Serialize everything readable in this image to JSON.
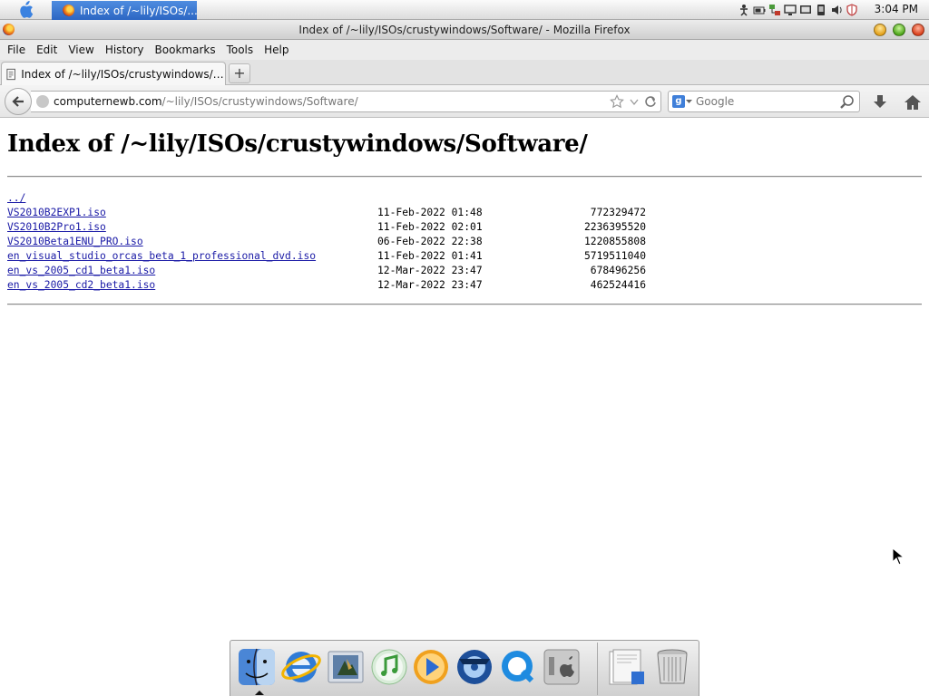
{
  "system_bar": {
    "task_label": "Index of /~lily/ISOs/...",
    "clock": "3:04 PM"
  },
  "window": {
    "title": "Index of /~lily/ISOs/crustywindows/Software/ - Mozilla Firefox"
  },
  "menu": {
    "items": [
      "File",
      "Edit",
      "View",
      "History",
      "Bookmarks",
      "Tools",
      "Help"
    ]
  },
  "tabs": {
    "active_label": "Index of /~lily/ISOs/crustywindows/So...",
    "new_tab_label": "+"
  },
  "navigation": {
    "url_domain": "computernewb.com",
    "url_path": "/~lily/ISOs/crustywindows/Software/",
    "search_engine": "Google",
    "search_placeholder": "Google"
  },
  "page": {
    "title": "Index of /~lily/ISOs/crustywindows/Software/",
    "parent_link": "../",
    "files": [
      {
        "name": "VS2010B2EXP1.iso",
        "date": "11-Feb-2022 01:48",
        "size": "772329472"
      },
      {
        "name": "VS2010B2Pro1.iso",
        "date": "11-Feb-2022 02:01",
        "size": "2236395520"
      },
      {
        "name": "VS2010Beta1ENU_PRO.iso",
        "date": "06-Feb-2022 22:38",
        "size": "1220855808"
      },
      {
        "name": "en_visual_studio_orcas_beta_1_professional_dvd.iso",
        "date": "11-Feb-2022 01:41",
        "size": "5719511040"
      },
      {
        "name": "en_vs_2005_cd1_beta1.iso",
        "date": "12-Mar-2022 23:47",
        "size": "678496256"
      },
      {
        "name": "en_vs_2005_cd2_beta1.iso",
        "date": "12-Mar-2022 23:47",
        "size": "462524416"
      }
    ]
  },
  "dock": {
    "icons": [
      "finder-icon",
      "internet-explorer-icon",
      "mail-icon",
      "itunes-icon",
      "media-player-icon",
      "dvd-player-icon",
      "quicktime-icon",
      "system-preferences-icon",
      "documents-stack-icon",
      "trash-icon"
    ]
  },
  "colors": {
    "link": "#1a1aa6",
    "task_button": "#2c66c3"
  }
}
